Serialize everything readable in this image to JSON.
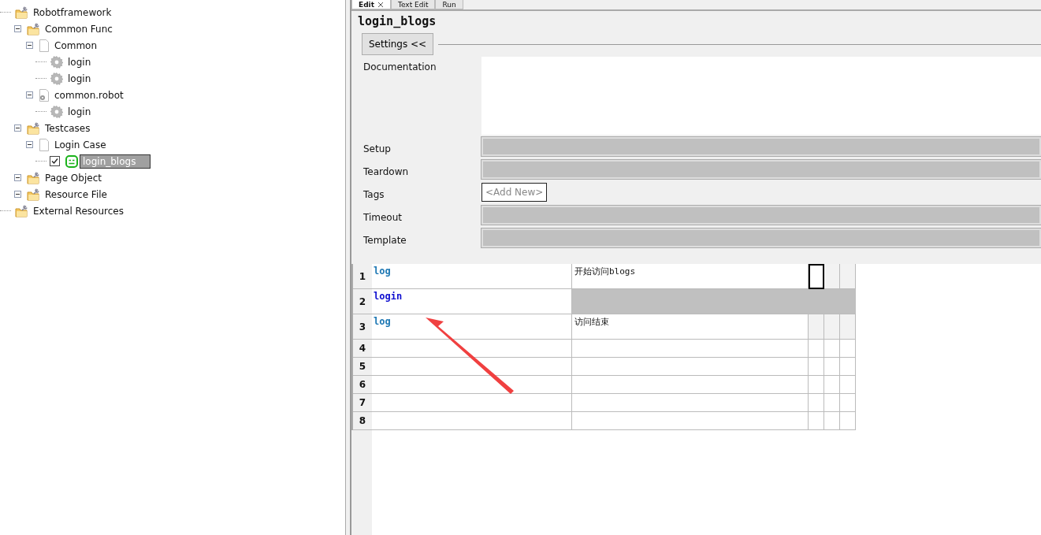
{
  "tree": [
    {
      "label": "Robotframework",
      "kind": "project",
      "children": [
        {
          "label": "Common Func",
          "kind": "project",
          "expanded": true,
          "children": [
            {
              "label": "Common",
              "kind": "file",
              "expanded": true,
              "children": [
                {
                  "label": "login",
                  "kind": "keyword"
                },
                {
                  "label": "login",
                  "kind": "keyword"
                }
              ]
            },
            {
              "label": "common.robot",
              "kind": "resource_file",
              "expanded": true,
              "children": [
                {
                  "label": "login",
                  "kind": "keyword"
                }
              ]
            }
          ]
        },
        {
          "label": "Testcases",
          "kind": "project",
          "expanded": true,
          "children": [
            {
              "label": "Login Case",
              "kind": "file",
              "expanded": true,
              "children": [
                {
                  "label": "login_blogs",
                  "kind": "testcase",
                  "checked": true,
                  "selected": true
                }
              ]
            }
          ]
        },
        {
          "label": "Page Object",
          "kind": "project",
          "expanded": true
        },
        {
          "label": "Resource File",
          "kind": "project",
          "expanded": true
        }
      ]
    },
    {
      "label": "External Resources",
      "kind": "project"
    }
  ],
  "tabs": [
    {
      "label": "Edit",
      "closable": true,
      "selected": true
    },
    {
      "label": "Text Edit",
      "selected": false
    },
    {
      "label": "Run",
      "selected": false
    }
  ],
  "editor": {
    "title": "login_blogs",
    "settings_button": "Settings <<",
    "settings": [
      {
        "label": "Documentation",
        "kind": "textarea"
      },
      {
        "label": "Setup",
        "kind": "field"
      },
      {
        "label": "Teardown",
        "kind": "field"
      },
      {
        "label": "Tags",
        "kind": "tags",
        "placeholder": "<Add New>"
      },
      {
        "label": "Timeout",
        "kind": "field"
      },
      {
        "label": "Template",
        "kind": "field"
      }
    ],
    "steps": [
      {
        "number": "1",
        "keyword": "log",
        "user_keyword": false,
        "argument": "开始访问blogs",
        "cursor": true,
        "args_disabled": false
      },
      {
        "number": "2",
        "keyword": "login",
        "user_keyword": true,
        "args_disabled": true
      },
      {
        "number": "3",
        "keyword": "log",
        "user_keyword": false,
        "argument": "访问结束",
        "args_disabled": false
      },
      {
        "number": "4"
      },
      {
        "number": "5"
      },
      {
        "number": "6"
      },
      {
        "number": "7"
      },
      {
        "number": "8"
      }
    ]
  }
}
